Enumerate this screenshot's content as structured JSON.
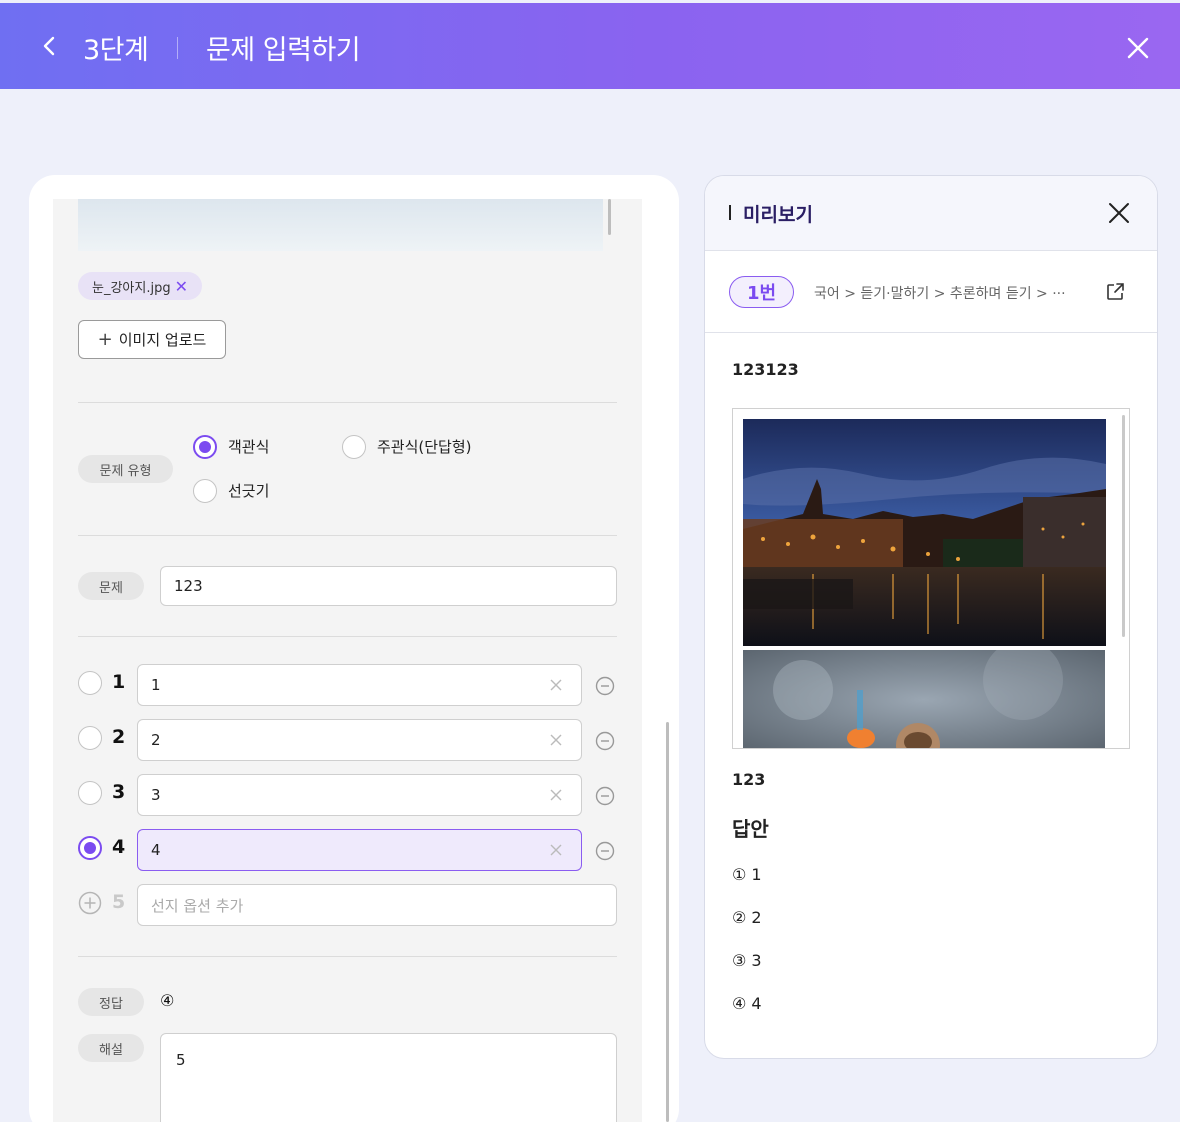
{
  "header": {
    "step": "3단계",
    "title": "문제 입력하기"
  },
  "editor": {
    "file_name": "눈_강아지.jpg",
    "upload_label": "이미지 업로드",
    "type_label": "문제 유형",
    "types": [
      {
        "label": "객관식",
        "selected": true
      },
      {
        "label": "주관식(단답형)",
        "selected": false
      },
      {
        "label": "선긋기",
        "selected": false
      }
    ],
    "question_label": "문제",
    "question_value": "123",
    "options": [
      {
        "num": "1",
        "value": "1",
        "selected": false
      },
      {
        "num": "2",
        "value": "2",
        "selected": false
      },
      {
        "num": "3",
        "value": "3",
        "selected": false
      },
      {
        "num": "4",
        "value": "4",
        "selected": true
      }
    ],
    "add_option_num": "5",
    "add_option_placeholder": "선지 옵션 추가",
    "answer_label": "정답",
    "answer_value": "④",
    "explanation_label": "해설",
    "explanation_value": "5"
  },
  "preview": {
    "title": "미리보기",
    "number": "1번",
    "breadcrumb": "국어 > 듣기·말하기 > 추론하며 듣기 > ···",
    "question": "123123",
    "text": "123",
    "answer_heading": "답안",
    "options": [
      "① 1",
      "② 2",
      "③ 3",
      "④ 4"
    ]
  },
  "colors": {
    "accent": "#7b4bf0",
    "header_start": "#6f6ff2",
    "header_end": "#9a67f1",
    "background": "#eef0fa"
  },
  "icons": [
    "chevron-left-icon",
    "close-icon",
    "plus-icon",
    "clear-icon",
    "minus-circle-icon",
    "plus-circle-icon",
    "external-link-icon"
  ]
}
